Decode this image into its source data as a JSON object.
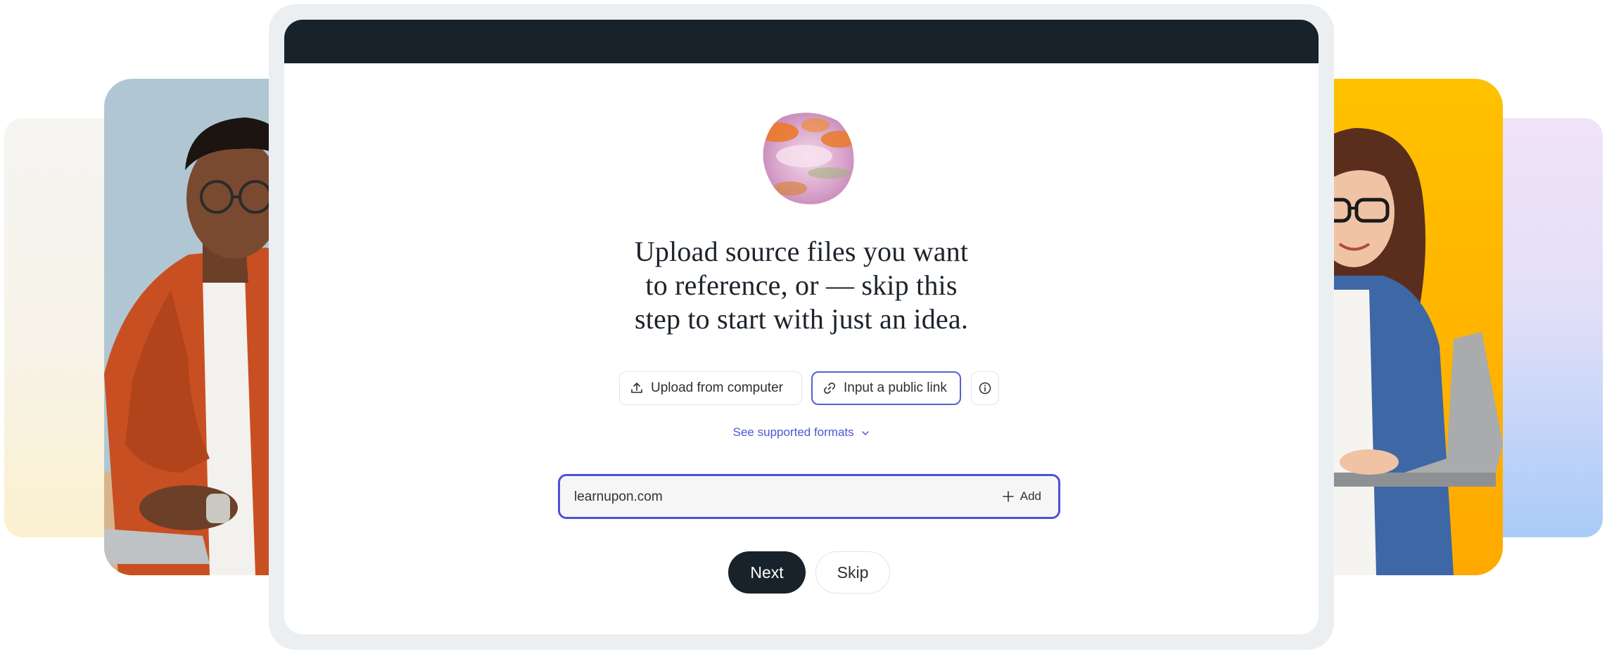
{
  "headline": {
    "line1": "Upload source files you want",
    "line2": "to reference, or — skip this",
    "line3": "step to start with just an idea."
  },
  "source_buttons": {
    "upload_label": "Upload from computer",
    "link_label": "Input a public link"
  },
  "formats_link": "See supported formats",
  "url_field": {
    "value": "learnupon.com",
    "add_label": "Add"
  },
  "actions": {
    "next_label": "Next",
    "skip_label": "Skip"
  },
  "colors": {
    "accent": "#4b52d8",
    "dark": "#17222a",
    "left_photo_bg": "#b0c7d3",
    "right_photo_bg": "#ffb200"
  },
  "icons": {
    "upload": "upload-icon",
    "link": "link-icon",
    "info": "info-icon",
    "chevron": "chevron-down-icon",
    "add": "plus-icon"
  }
}
